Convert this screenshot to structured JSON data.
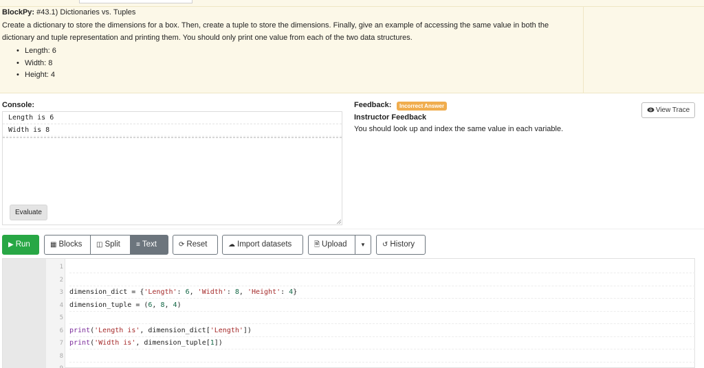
{
  "assignment": {
    "app_name": "BlockPy:",
    "title": "#43.1) Dictionaries vs. Tuples",
    "description": "Create a dictionary to store the dimensions for a box. Then, create a tuple to store the dimensions. Finally, give an example of accessing the same value in both the dictionary and tuple representation and printing them. You should only print one value from each of the two data structures.",
    "bullets": [
      "Length: 6",
      "Width: 8",
      "Height: 4"
    ]
  },
  "console": {
    "label": "Console:",
    "lines": [
      "Length is 6",
      "Width is 8"
    ],
    "evaluate_label": "Evaluate"
  },
  "feedback": {
    "label": "Feedback:",
    "badge": "Incorrect Answer",
    "badge_color": "#f0ad4e",
    "title": "Instructor Feedback",
    "message": "You should look up and index the same value in each variable.",
    "view_trace_label": "View Trace",
    "view_trace_icon": "eye-icon"
  },
  "toolbar": {
    "run_label": "Run",
    "run_color": "#28a745",
    "blocks_label": "Blocks",
    "split_label": "Split",
    "text_label": "Text",
    "reset_label": "Reset",
    "import_label": "Import datasets",
    "upload_label": "Upload",
    "history_label": "History"
  },
  "editor": {
    "lines": [
      "",
      "",
      "dimension_dict = {'Length': 6, 'Width': 8, 'Height': 4}",
      "dimension_tuple = (6, 8, 4)",
      "",
      "print('Length is', dimension_dict['Length'])",
      "print('Width is', dimension_tuple[1])",
      "",
      ""
    ],
    "line_numbers": [
      "1",
      "2",
      "3",
      "4",
      "5",
      "6",
      "7",
      "8",
      "9"
    ]
  }
}
